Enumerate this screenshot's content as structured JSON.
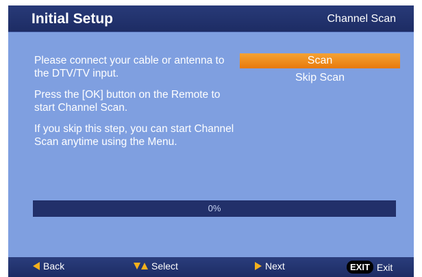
{
  "header": {
    "title": "Initial  Setup",
    "crumb": "Channel Scan"
  },
  "instructions": [
    "Please connect your cable or antenna to the DTV/TV input.",
    "Press the [OK] button on the Remote to start Channel Scan.",
    "If you skip this step, you can start Channel Scan anytime using the Menu."
  ],
  "menu": {
    "items": [
      {
        "label": "Scan",
        "selected": true
      },
      {
        "label": "Skip Scan",
        "selected": false
      }
    ]
  },
  "progress": {
    "value": 0,
    "label": "0%"
  },
  "footer": {
    "back_label": "Back",
    "back_icon": "left-arrow-icon",
    "select_label": "Select",
    "select_icon": "up-down-arrows-icon",
    "next_label": "Next",
    "next_icon": "right-arrow-icon",
    "exit_key": "EXIT",
    "exit_label": "Exit"
  },
  "colors": {
    "background": "#7f9fe0",
    "header": "#1d2c64",
    "highlight": "#e87a0c",
    "arrow": "#f5b01c"
  }
}
